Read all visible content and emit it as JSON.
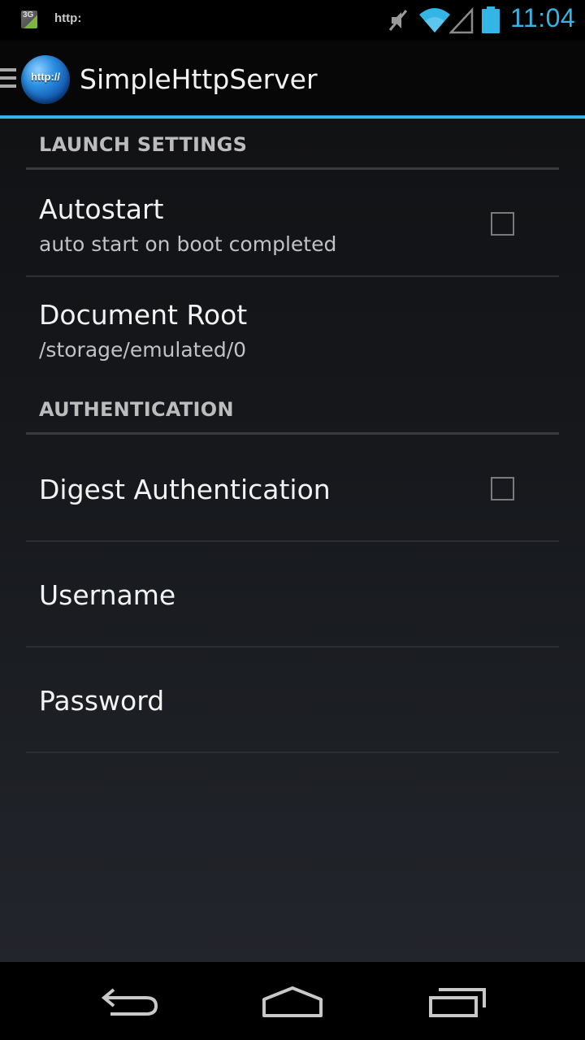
{
  "status_bar": {
    "notification_icon": "3g-notification-icon",
    "notification_icon_label": "3G",
    "notification_text": "http:",
    "icons": [
      "mute-icon",
      "wifi-icon",
      "signal-icon",
      "battery-icon"
    ],
    "time": "11:04",
    "time_color": "#33b5e5"
  },
  "action_bar": {
    "menu_icon": "menu-icon",
    "logo_text": "http://",
    "title": "SimpleHttpServer",
    "accent_color": "#33b5e5"
  },
  "sections": {
    "launch": {
      "header": "LAUNCH SETTINGS",
      "autostart": {
        "title": "Autostart",
        "summary": "auto start on boot completed",
        "checked": false
      },
      "document_root": {
        "title": "Document Root",
        "summary": "/storage/emulated/0"
      }
    },
    "auth": {
      "header": "AUTHENTICATION",
      "digest": {
        "title": "Digest Authentication",
        "checked": false
      },
      "username": {
        "title": "Username"
      },
      "password": {
        "title": "Password"
      }
    }
  },
  "nav_bar": {
    "buttons": [
      "back-icon",
      "home-icon",
      "recent-apps-icon"
    ]
  }
}
